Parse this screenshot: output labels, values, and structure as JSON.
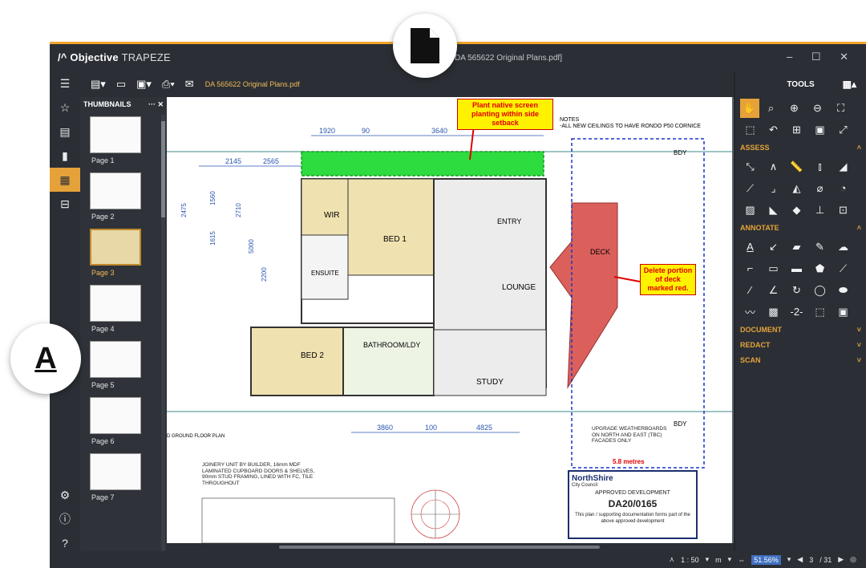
{
  "window": {
    "title": "DA 565622 Original Plans.pdf]",
    "brand_bold": "Objective",
    "brand_thin": "TRAPEZE",
    "controls": "– ☐ ✕"
  },
  "toolbar": {
    "file_tab": "DA 565622 Original Plans.pdf"
  },
  "thumbnails": {
    "heading": "THUMBNAILS",
    "pages": [
      {
        "label": "Page 1"
      },
      {
        "label": "Page 2"
      },
      {
        "label": "Page 3"
      },
      {
        "label": "Page 4"
      },
      {
        "label": "Page 5"
      },
      {
        "label": "Page 6"
      },
      {
        "label": "Page 7"
      }
    ],
    "active_index": 2
  },
  "plan": {
    "note_title": "NOTES",
    "note_line": "-ALL NEW CEILINGS TO HAVE RONDO P50 CORNICE",
    "annotation_planting": "Plant native screen planting within side setback",
    "annotation_deck": "Delete portion of deck marked red.",
    "distance": "5.8 metres",
    "dims_top": [
      "1920",
      "90",
      "3640"
    ],
    "dims_row2": [
      "2145",
      "2565"
    ],
    "dims_bottom": [
      "3860",
      "100",
      "4825"
    ],
    "dims_left": [
      "2475",
      "1560",
      "1615",
      "2710",
      "5000",
      "2200"
    ],
    "rooms": [
      "WIR",
      "BED 1",
      "ENTRY",
      "DECK",
      "ENSUITE",
      "LOUNGE",
      "BED 2",
      "BATHROOM/LDY",
      "STUDY"
    ],
    "ground_floor": "D GROUND FLOOR PLAN",
    "joinery": "JOINERY UNIT BY BUILDER, 16mm MDF LAMINATED CUPBOARD DOORS & SHELVES, 90mm STUD FRAMING, LINED WITH FC, TILE THROUGHOUT",
    "upgrade_note": "UPGRADE WEATHERBOARDS ON NORTH AND EAST (TBC) FACADES ONLY",
    "boundary": "BDY",
    "stamp": {
      "council": "NorthShire",
      "council_sub": "City Council",
      "approved": "APPROVED DEVELOPMENT",
      "number": "DA20/0165",
      "note": "This plan / supporting documentation forms part of the above approved development"
    }
  },
  "tools": {
    "heading": "TOOLS",
    "sections": [
      "ASSESS",
      "ANNOTATE",
      "DOCUMENT",
      "REDACT",
      "SCAN"
    ]
  },
  "status": {
    "scale": "1 : 50",
    "unit": "m",
    "zoom": "51.56%",
    "page": "3",
    "page_total": "/ 31"
  }
}
